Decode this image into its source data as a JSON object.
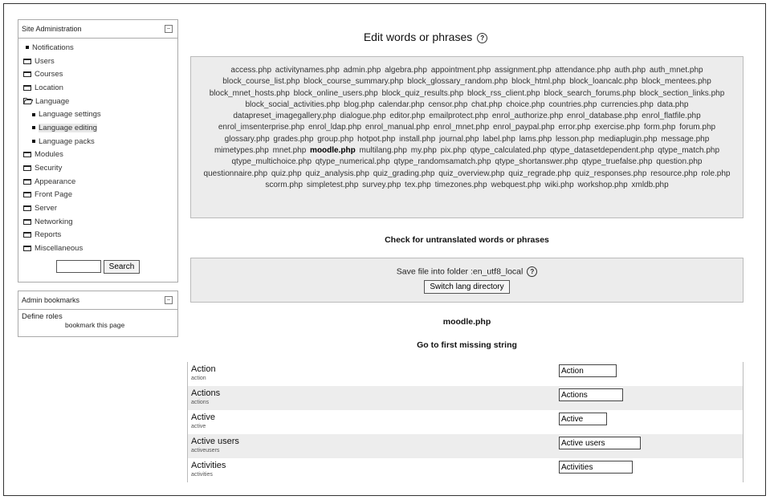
{
  "site_admin": {
    "title": "Site Administration",
    "collapse": "−",
    "items": [
      {
        "label": "Notifications",
        "icon": "bullet",
        "sub": false
      },
      {
        "label": "Users",
        "icon": "folder",
        "sub": false
      },
      {
        "label": "Courses",
        "icon": "folder",
        "sub": false
      },
      {
        "label": "Location",
        "icon": "folder",
        "sub": false
      },
      {
        "label": "Language",
        "icon": "folder-open",
        "sub": false
      },
      {
        "label": "Language settings",
        "icon": "bullet",
        "sub": true
      },
      {
        "label": "Language editing",
        "icon": "bullet",
        "sub": true,
        "active": true
      },
      {
        "label": "Language packs",
        "icon": "bullet",
        "sub": true
      },
      {
        "label": "Modules",
        "icon": "folder",
        "sub": false
      },
      {
        "label": "Security",
        "icon": "folder",
        "sub": false
      },
      {
        "label": "Appearance",
        "icon": "folder",
        "sub": false
      },
      {
        "label": "Front Page",
        "icon": "folder",
        "sub": false
      },
      {
        "label": "Server",
        "icon": "folder",
        "sub": false
      },
      {
        "label": "Networking",
        "icon": "folder",
        "sub": false
      },
      {
        "label": "Reports",
        "icon": "folder",
        "sub": false
      },
      {
        "label": "Miscellaneous",
        "icon": "folder",
        "sub": false
      }
    ],
    "search_value": "",
    "search_button": "Search"
  },
  "bookmarks": {
    "title": "Admin bookmarks",
    "collapse": "−",
    "link": "Define roles",
    "action": "bookmark this page"
  },
  "main": {
    "title": "Edit words or phrases",
    "help": "?",
    "files": [
      "access.php",
      "activitynames.php",
      "admin.php",
      "algebra.php",
      "appointment.php",
      "assignment.php",
      "attendance.php",
      "auth.php",
      "auth_mnet.php",
      "block_course_list.php",
      "block_course_summary.php",
      "block_glossary_random.php",
      "block_html.php",
      "block_loancalc.php",
      "block_mentees.php",
      "block_mnet_hosts.php",
      "block_online_users.php",
      "block_quiz_results.php",
      "block_rss_client.php",
      "block_search_forums.php",
      "block_section_links.php",
      "block_social_activities.php",
      "blog.php",
      "calendar.php",
      "censor.php",
      "chat.php",
      "choice.php",
      "countries.php",
      "currencies.php",
      "data.php",
      "datapreset_imagegallery.php",
      "dialogue.php",
      "editor.php",
      "emailprotect.php",
      "enrol_authorize.php",
      "enrol_database.php",
      "enrol_flatfile.php",
      "enrol_imsenterprise.php",
      "enrol_ldap.php",
      "enrol_manual.php",
      "enrol_mnet.php",
      "enrol_paypal.php",
      "error.php",
      "exercise.php",
      "form.php",
      "forum.php",
      "glossary.php",
      "grades.php",
      "group.php",
      "hotpot.php",
      "install.php",
      "journal.php",
      "label.php",
      "lams.php",
      "lesson.php",
      "mediaplugin.php",
      "message.php",
      "mimetypes.php",
      "mnet.php",
      "moodle.php",
      "multilang.php",
      "my.php",
      "pix.php",
      "qtype_calculated.php",
      "qtype_datasetdependent.php",
      "qtype_match.php",
      "qtype_multichoice.php",
      "qtype_numerical.php",
      "qtype_randomsamatch.php",
      "qtype_shortanswer.php",
      "qtype_truefalse.php",
      "question.php",
      "questionnaire.php",
      "quiz.php",
      "quiz_analysis.php",
      "quiz_grading.php",
      "quiz_overview.php",
      "quiz_regrade.php",
      "quiz_responses.php",
      "resource.php",
      "role.php",
      "scorm.php",
      "simpletest.php",
      "survey.php",
      "tex.php",
      "timezones.php",
      "webquest.php",
      "wiki.php",
      "workshop.php",
      "xmldb.php"
    ],
    "current_file": "moodle.php",
    "untranslated_link": "Check for untranslated words or phrases",
    "save_text": "Save file into folder :en_utf8_local",
    "switch_button": "Switch lang directory",
    "file_heading": "moodle.php",
    "first_missing": "Go to first missing string",
    "strings": [
      {
        "label": "Action",
        "key": "action",
        "value": "Action"
      },
      {
        "label": "Actions",
        "key": "actions",
        "value": "Actions"
      },
      {
        "label": "Active",
        "key": "active",
        "value": "Active"
      },
      {
        "label": "Active users",
        "key": "activeusers",
        "value": "Active users"
      },
      {
        "label": "Activities",
        "key": "activities",
        "value": "Activities"
      }
    ]
  }
}
